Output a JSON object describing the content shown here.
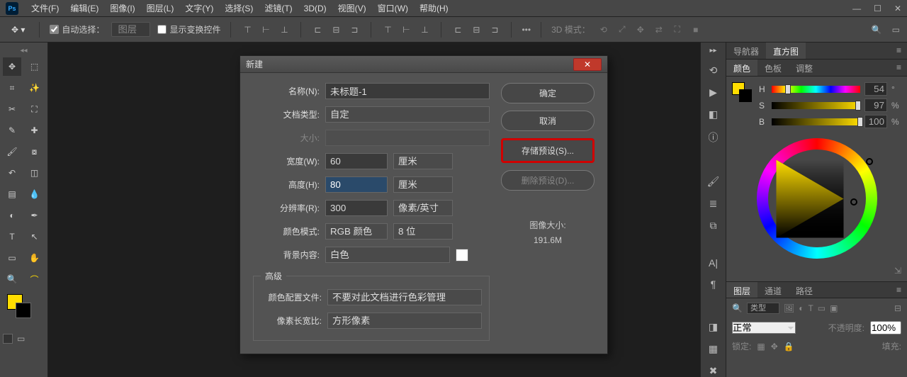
{
  "menubar": {
    "items": [
      "文件(F)",
      "编辑(E)",
      "图像(I)",
      "图层(L)",
      "文字(Y)",
      "选择(S)",
      "滤镜(T)",
      "3D(D)",
      "视图(V)",
      "窗口(W)",
      "帮助(H)"
    ]
  },
  "optionsbar": {
    "auto_select": "自动选择：",
    "layer_dropdown": "图层",
    "show_transform": "显示变换控件",
    "mode_3d": "3D 模式："
  },
  "dialog": {
    "title": "新建",
    "name_label": "名称(N):",
    "name_value": "未标题-1",
    "doctype_label": "文档类型:",
    "doctype_value": "自定",
    "size_label": "大小:",
    "width_label": "宽度(W):",
    "width_value": "60",
    "width_unit": "厘米",
    "height_label": "高度(H):",
    "height_value": "80",
    "height_unit": "厘米",
    "resolution_label": "分辨率(R):",
    "resolution_value": "300",
    "resolution_unit": "像素/英寸",
    "colormode_label": "颜色模式:",
    "colormode_value": "RGB 颜色",
    "colordepth_value": "8 位",
    "bg_label": "背景内容:",
    "bg_value": "白色",
    "advanced": "高级",
    "profile_label": "颜色配置文件:",
    "profile_value": "不要对此文档进行色彩管理",
    "aspect_label": "像素长宽比:",
    "aspect_value": "方形像素",
    "ok": "确定",
    "cancel": "取消",
    "save_preset": "存储预设(S)...",
    "delete_preset": "删除预设(D)...",
    "image_size_label": "图像大小:",
    "image_size_value": "191.6M"
  },
  "panels": {
    "nav_tab": "导航器",
    "histogram_tab": "直方图",
    "color_tab": "颜色",
    "swatch_tab": "色板",
    "adjust_tab": "调整",
    "h_val": "54",
    "s_val": "97",
    "b_val": "100",
    "deg": "°",
    "pct": "%",
    "layers_tab": "图层",
    "channels_tab": "通道",
    "paths_tab": "路径",
    "kind_label": "类型",
    "blend_mode": "正常",
    "opacity_label": "不透明度:",
    "opacity_val": "100%",
    "lock_label": "锁定:",
    "fill_label": "填充:"
  },
  "search_placeholder": "搜"
}
